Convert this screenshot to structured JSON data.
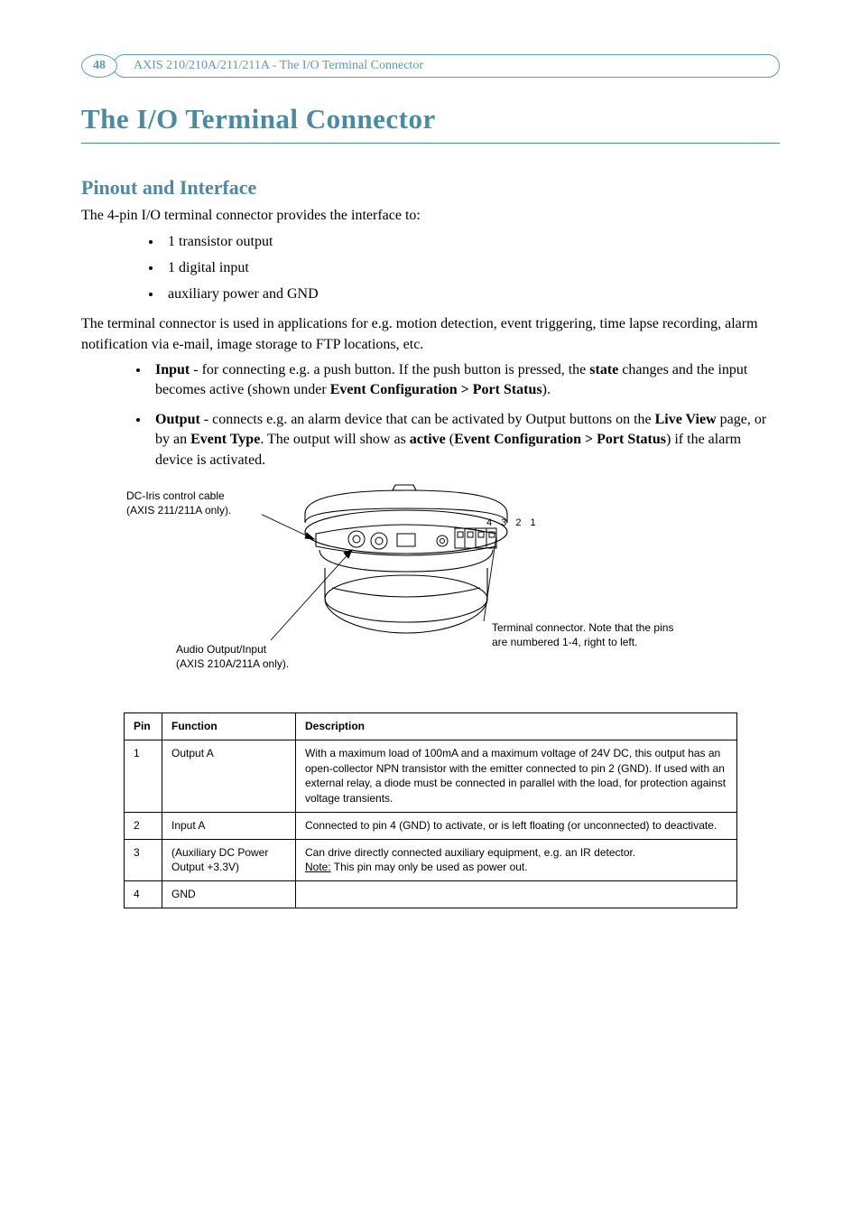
{
  "page_number": "48",
  "header_text": "AXIS 210/210A/211/211A - The I/O Terminal Connector",
  "title": "The I/O Terminal Connector",
  "section_title": "Pinout and Interface",
  "intro": "The 4-pin I/O terminal connector provides the interface to:",
  "interface_bullets": [
    "1 transistor output",
    "1 digital input",
    "auxiliary power and GND"
  ],
  "para2": "The terminal connector is used in applications for e.g. motion detection, event triggering, time lapse recording, alarm notification via e-mail, image storage to FTP locations, etc.",
  "io_bullets": [
    {
      "lead": "Input",
      "rest1": " - for connecting e.g. a push button. If the push button is pressed, the ",
      "bold2": "state",
      "rest2": " changes and the input becomes active (shown under ",
      "bold3": "Event Configuration > Port Status",
      "rest3": ")."
    },
    {
      "lead": "Output",
      "rest1": " - connects e.g. an alarm device that can be activated by Output buttons on the ",
      "bold2": "Live View",
      "rest2": " page, or by an ",
      "bold3": "Event Type",
      "rest3": ". The output will show as ",
      "bold4": "active",
      "rest4": " (",
      "bold5": "Event Configuration > Port Status",
      "rest5": ") if the alarm device is activated."
    }
  ],
  "fig_label_dciris_l1": "DC-Iris control cable",
  "fig_label_dciris_l2": "(AXIS 211/211A only).",
  "fig_label_audio_l1": "Audio Output/Input",
  "fig_label_audio_l2": "(AXIS 210A/211A only).",
  "fig_label_terminal_l1": "Terminal connector. Note that the pins",
  "fig_label_terminal_l2": "are numbered 1-4, right to left.",
  "pin_labels": "4  3  2  1",
  "pinout_table": {
    "headers": [
      "Pin",
      "Function",
      "Description"
    ],
    "rows": [
      {
        "pin": "1",
        "func": "Output A",
        "desc": "With a maximum load of 100mA and a maximum voltage of 24V DC, this output has an open-collector NPN transistor with the emitter connected to pin 2 (GND). If used with an external relay, a diode must be connected in parallel with the load, for protection against voltage transients."
      },
      {
        "pin": "2",
        "func": "Input A",
        "desc": "Connected to pin 4 (GND) to activate, or is left floating (or unconnected) to deactivate."
      },
      {
        "pin": "3",
        "func": "(Auxiliary DC Power Output +3.3V)",
        "desc_l1": "Can drive directly connected auxiliary equipment, e.g. an IR detector.",
        "desc_l2_lead": "Note:",
        "desc_l2_rest": " This pin may only be used as power out."
      },
      {
        "pin": "4",
        "func": "GND",
        "desc": ""
      }
    ]
  }
}
